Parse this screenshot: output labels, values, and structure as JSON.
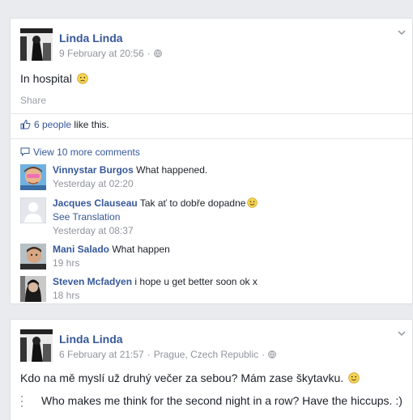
{
  "post1": {
    "author": "Linda Linda",
    "timestamp": "9 February at 20:56",
    "meta_separator": "·",
    "text": "In hospital",
    "share_label": "Share",
    "likes_count": "6 people",
    "likes_suffix": "like this.",
    "view_more_comments": "View 10 more comments",
    "comments": [
      {
        "author": "Vinnystar Burgos",
        "text": "What happened.",
        "time": "Yesterday at 02:20"
      },
      {
        "author": "Jacques Clauseau",
        "text": "Tak ať to dobře dopadne",
        "translate": "See Translation",
        "time": "Yesterday at 08:37"
      },
      {
        "author": "Mani Salado",
        "text": "What happen",
        "time": "19 hrs"
      },
      {
        "author": "Steven Mcfadyen",
        "text": "i hope u get better soon ok x",
        "time": "18 hrs"
      }
    ]
  },
  "post2": {
    "author": "Linda Linda",
    "timestamp": "6 February at 21:57",
    "meta_separator": "·",
    "location": "Prague, Czech Republic",
    "text": "Kdo na mě myslí už druhý večer za sebou? Mám zase škytavku.",
    "translation": "Who makes me think for the second night in a row? Have the hiccups. :)"
  },
  "colors": {
    "link": "#365899",
    "muted": "#90949c",
    "background": "#e9ebee"
  },
  "icons": [
    "chevron-down-icon",
    "globe-icon",
    "sad-emoji-icon",
    "smile-emoji-icon",
    "thumbs-up-icon",
    "comment-bubble-icon"
  ]
}
